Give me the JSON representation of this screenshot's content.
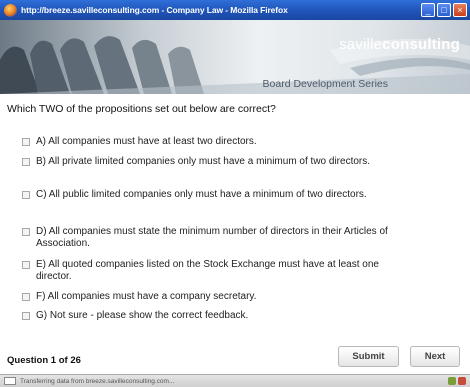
{
  "window": {
    "title": "http://breeze.savilleconsulting.com - Company Law - Mozilla Firefox"
  },
  "banner": {
    "brand_left": "saville",
    "brand_right": "consulting",
    "series": "Board Development Series"
  },
  "question": {
    "text": "Which TWO of the propositions set out below are correct?",
    "counter": "Question 1 of 26"
  },
  "options": [
    {
      "label": "A) All companies must have at least two directors."
    },
    {
      "label": "B) All private limited companies only must have a minimum of two directors."
    },
    {
      "label": "C) All public limited companies only must have a minimum of two directors."
    },
    {
      "label": "D) All companies must state the minimum number of directors in their Articles of Association."
    },
    {
      "label": "E) All quoted companies listed on the Stock Exchange must have at least one director."
    },
    {
      "label": "F) All companies must have a company secretary."
    },
    {
      "label": "G) Not sure - please show the correct feedback."
    }
  ],
  "buttons": {
    "submit": "Submit",
    "next": "Next"
  },
  "statusbar": {
    "text": "Transferring data from breeze.savilleconsulting.com..."
  }
}
